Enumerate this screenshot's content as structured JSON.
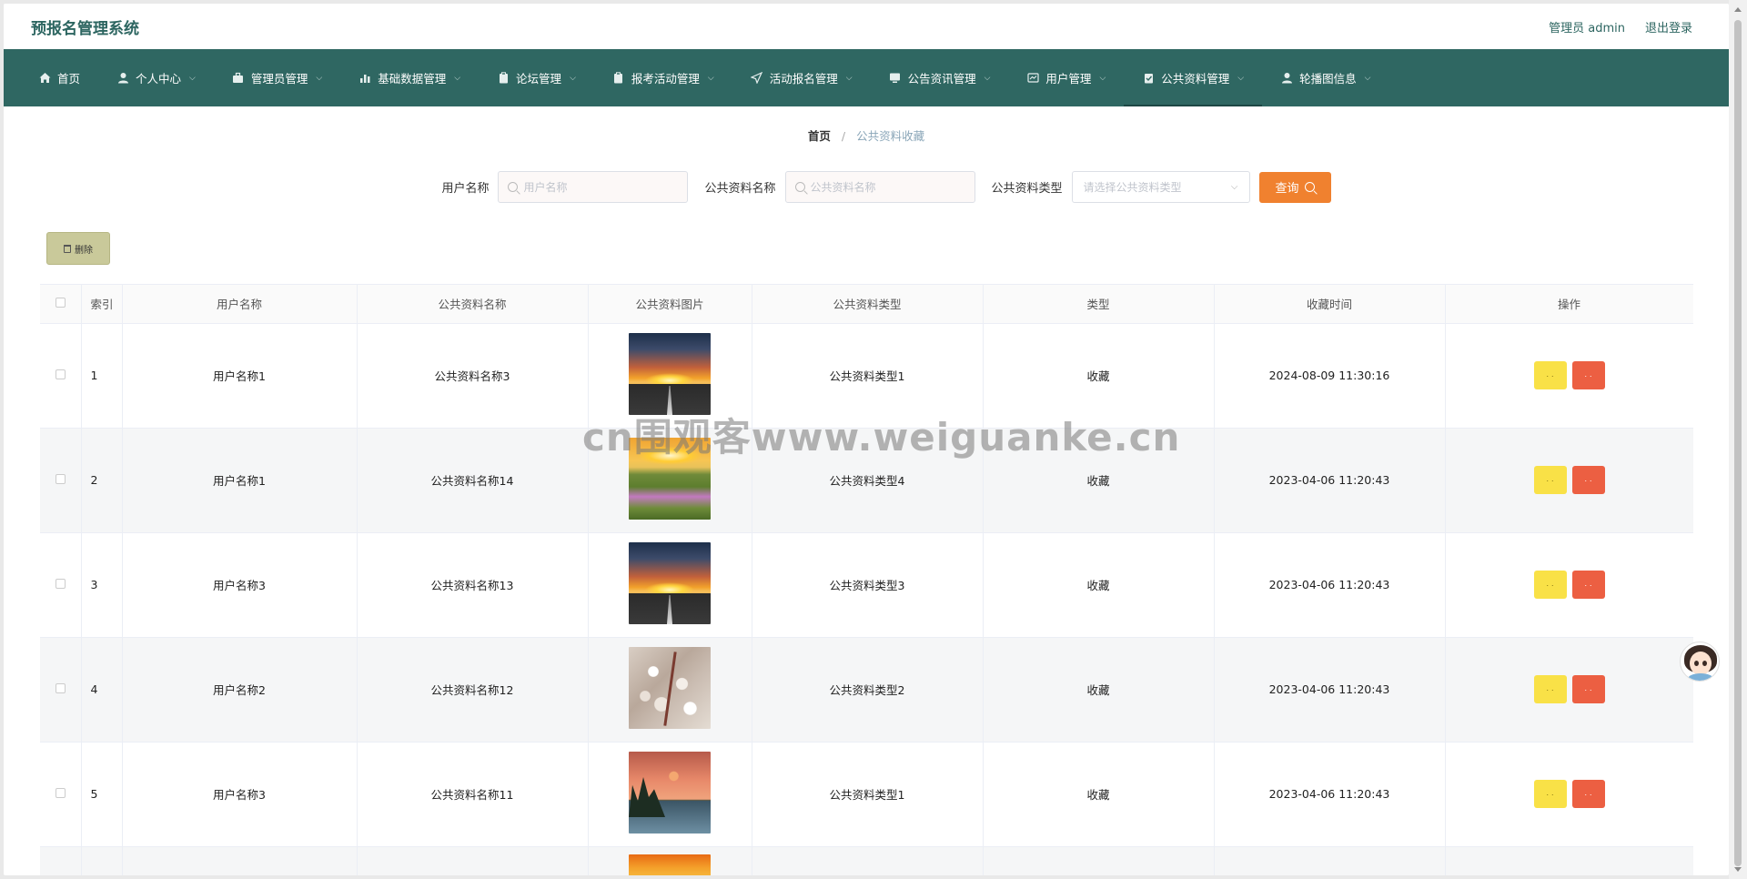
{
  "header": {
    "app_title": "预报名管理系统",
    "admin_label": "管理员 admin",
    "logout_label": "退出登录"
  },
  "nav": [
    {
      "label": "首页",
      "icon": "home-icon",
      "has_dropdown": false
    },
    {
      "label": "个人中心",
      "icon": "user-icon",
      "has_dropdown": true
    },
    {
      "label": "管理员管理",
      "icon": "briefcase-icon",
      "has_dropdown": true
    },
    {
      "label": "基础数据管理",
      "icon": "bar-chart-icon",
      "has_dropdown": true
    },
    {
      "label": "论坛管理",
      "icon": "clipboard-icon",
      "has_dropdown": true
    },
    {
      "label": "报考活动管理",
      "icon": "clipboard-icon",
      "has_dropdown": true
    },
    {
      "label": "活动报名管理",
      "icon": "send-icon",
      "has_dropdown": true
    },
    {
      "label": "公告资讯管理",
      "icon": "monitor-icon",
      "has_dropdown": true
    },
    {
      "label": "用户管理",
      "icon": "chart-box-icon",
      "has_dropdown": true
    },
    {
      "label": "公共资料管理",
      "icon": "clipboard-check-icon",
      "has_dropdown": true,
      "active": true
    },
    {
      "label": "轮播图信息",
      "icon": "user-icon",
      "has_dropdown": true
    }
  ],
  "breadcrumb": {
    "home": "首页",
    "separator": "/",
    "current": "公共资料收藏"
  },
  "search": {
    "username_label": "用户名称",
    "username_placeholder": "用户名称",
    "name_label": "公共资料名称",
    "name_placeholder": "公共资料名称",
    "type_label": "公共资料类型",
    "type_placeholder": "请选择公共资料类型",
    "query_button": "查询"
  },
  "delete_button": "删除",
  "table": {
    "columns": [
      "索引",
      "用户名称",
      "公共资料名称",
      "公共资料图片",
      "公共资料类型",
      "类型",
      "收藏时间",
      "操作"
    ],
    "rows": [
      {
        "index": "1",
        "user": "用户名称1",
        "name": "公共资料名称3",
        "image": "sunset-road",
        "type": "公共资料类型1",
        "kind": "收藏",
        "time": "2024-08-09 11:30:16"
      },
      {
        "index": "2",
        "user": "用户名称1",
        "name": "公共资料名称14",
        "image": "flower-field",
        "type": "公共资料类型4",
        "kind": "收藏",
        "time": "2023-04-06 11:20:43"
      },
      {
        "index": "3",
        "user": "用户名称3",
        "name": "公共资料名称13",
        "image": "sunset-road",
        "type": "公共资料类型3",
        "kind": "收藏",
        "time": "2023-04-06 11:20:43"
      },
      {
        "index": "4",
        "user": "用户名称2",
        "name": "公共资料名称12",
        "image": "blossom-branch",
        "type": "公共资料类型2",
        "kind": "收藏",
        "time": "2023-04-06 11:20:43"
      },
      {
        "index": "5",
        "user": "用户名称3",
        "name": "公共资料名称11",
        "image": "lake-sunset",
        "type": "公共资料类型1",
        "kind": "收藏",
        "time": "2023-04-06 11:20:43"
      },
      {
        "index": "",
        "user": "",
        "name": "",
        "image": "orange-sky",
        "type": "",
        "kind": "",
        "time": ""
      }
    ],
    "view_button": "· ·",
    "delete_button": "· ·"
  },
  "watermark": "cn围观客www.weiguanke.cn",
  "colors": {
    "nav_bg": "#2f6762",
    "query_btn": "#f0812f",
    "view_btn": "#f9e147",
    "delete_btn": "#ec5f42",
    "bulk_delete_btn": "#c9c99a"
  }
}
